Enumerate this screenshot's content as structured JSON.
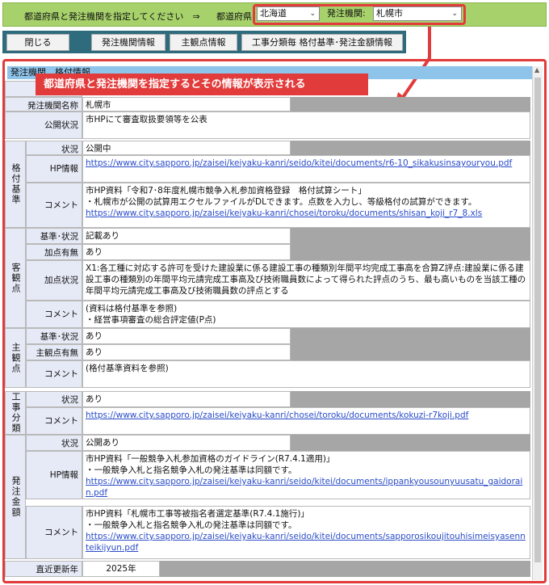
{
  "topbar": {
    "prompt": "都道府県と発注機関を指定してください　⇒",
    "pref_label": "都道府県",
    "pref_value": "北海道",
    "agency_label": "発注機関:",
    "agency_value": "札幌市"
  },
  "buttons": {
    "close": "閉じる",
    "agency_info": "発注機関情報",
    "subjective": "主観点情報",
    "work_type": "工事分類毎 格付基準･発注金額情報"
  },
  "panel": {
    "title": "発注機関　格付情報",
    "callout": "都道府県と発注機関を指定するとその情報が表示される"
  },
  "rows": {
    "agency_code_label": "発注",
    "agency_name_label": "発注機関名称",
    "agency_name": "札幌市",
    "public_label": "公開状況",
    "public_value": "市HPにて審査取扱要領等を公表",
    "rating": {
      "group": "格付基準",
      "status_label": "状況",
      "status": "公開中",
      "hp_label": "HP情報",
      "hp_url": "https://www.city.sapporo.jp/zaisei/keiyaku-kanri/seido/kitei/documents/r6-10_sikakusinsayouryou.pdf",
      "comment_label": "コメント",
      "comment_1": "市HP資料「令和7･8年度札幌市競争入札参加資格登録　格付試算シート」",
      "comment_2": "・札幌市が公開の試算用エクセルファイルがDLできます。点数を入力し、等級格付の試算ができます。",
      "comment_url": "https://www.city.sapporo.jp/zaisei/keiyaku-kanri/chosei/toroku/documents/shisan_koji_r7_8.xls"
    },
    "objective": {
      "group": "客観点",
      "basis_label": "基準･状況",
      "basis": "記載あり",
      "add_label": "加点有無",
      "add": "あり",
      "add_status_label": "加点状況",
      "add_status": "X1:各工種に対応する許可を受けた建設業に係る建設工事の種類別年間平均完成工事高を合算Z評点:建設業に係る建設工事の種類別の年間平均元請完成工事高及び技術職員数によって得られた評点のうち、最も高いものを当該工種の年間平均元請完成工事高及び技術職員数の評点とする",
      "comment_label": "コメント",
      "comment_1": "(資料は格付基準を参照)",
      "comment_2": "・経営事項審査の総合評定値(P点)"
    },
    "subjective": {
      "group": "主観点",
      "basis_label": "基準･状況",
      "basis": "あり",
      "has_label": "主観点有無",
      "has": "あり",
      "comment_label": "コメント",
      "comment": "(格付基準資料を参照)"
    },
    "work": {
      "group": "工事分類",
      "status_label": "状況",
      "status": "あり",
      "comment_label": "コメント",
      "comment_url": "https://www.city.sapporo.jp/zaisei/keiyaku-kanri/chosei/toroku/documents/kokuzi-r7koji.pdf"
    },
    "amount": {
      "group": "発注金額",
      "status_label": "状況",
      "status": "公開あり",
      "hp_label": "HP情報",
      "hp_1": "市HP資料「一般競争入札参加資格のガイドライン(R7.4.1適用)」",
      "hp_2": "・一般競争入札と指名競争入札の発注基準は同額です。",
      "hp_url": "https://www.city.sapporo.jp/zaisei/keiyaku-kanri/seido/kitei/documents/ippankyousounyuusatu_gaidorain.pdf",
      "comment_label": "コメント",
      "comment_1": "市HP資料「札幌市工事等被指名者選定基準(R7.4.1施行)」",
      "comment_2": "・一般競争入札と指名競争入札の発注基準は同額です。",
      "comment_url": "https://www.city.sapporo.jp/zaisei/keiyaku-kanri/seido/kitei/documents/sapporosikoujitouhisimeisyasennteikijyun.pdf"
    },
    "updated_label": "直近更新年",
    "updated": "2025年"
  },
  "colors": {
    "topbar": "#a7d26b",
    "accent": "#e23b3b",
    "header_cell": "#e6eaf6",
    "panel_title": "#8ec3ea",
    "button_bar": "#2e6b7c",
    "link": "#2a4cc9"
  },
  "icons": {
    "dropdown": "chevron-down-icon",
    "callout_arrow": "arrow-icon"
  }
}
